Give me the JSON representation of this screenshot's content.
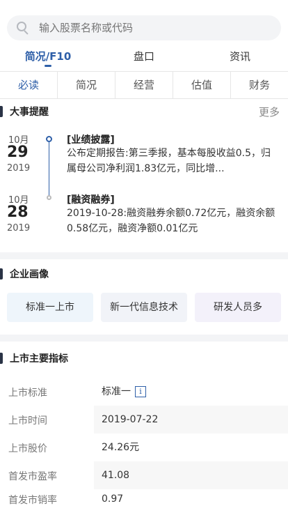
{
  "search": {
    "placeholder": "输入股票名称或代码"
  },
  "main_tabs": [
    {
      "label": "简况/F10",
      "active": true
    },
    {
      "label": "盘口",
      "active": false
    },
    {
      "label": "资讯",
      "active": false
    }
  ],
  "sub_tabs": [
    {
      "label": "必读",
      "active": true
    },
    {
      "label": "简况",
      "active": false
    },
    {
      "label": "经营",
      "active": false
    },
    {
      "label": "估值",
      "active": false
    },
    {
      "label": "财务",
      "active": false
    }
  ],
  "events_section": {
    "title": "大事提醒",
    "more_label": "更多",
    "items": [
      {
        "month": "10月",
        "day": "29",
        "year": "2019",
        "tag": "[业绩披露]",
        "text": "公布定期报告:第三季报，基本每股收益0.5，归属母公司净利润1.83亿元，同比增..."
      },
      {
        "month": "10月",
        "day": "28",
        "year": "2019",
        "tag": "[融资融券]",
        "text": "2019-10-28:融资融券余额0.72亿元，融资余额0.58亿元，融资净额0.01亿元"
      }
    ]
  },
  "profile_section": {
    "title": "企业画像",
    "tags": [
      "标准一上市",
      "新一代信息技术",
      "研发人员多"
    ]
  },
  "indicators_section": {
    "title": "上市主要指标",
    "rows": [
      {
        "label": "上市标准",
        "value": "标准一"
      },
      {
        "label": "上市时间",
        "value": "2019-07-22"
      },
      {
        "label": "上市股价",
        "value": "24.26元"
      },
      {
        "label": "首发市盈率",
        "value": "41.08"
      },
      {
        "label": "首发市销率",
        "value": "0.97"
      }
    ],
    "info_icon_glyph": "i"
  },
  "colors": {
    "accent": "#2e5fa8",
    "divider": "#f3f4f6"
  }
}
